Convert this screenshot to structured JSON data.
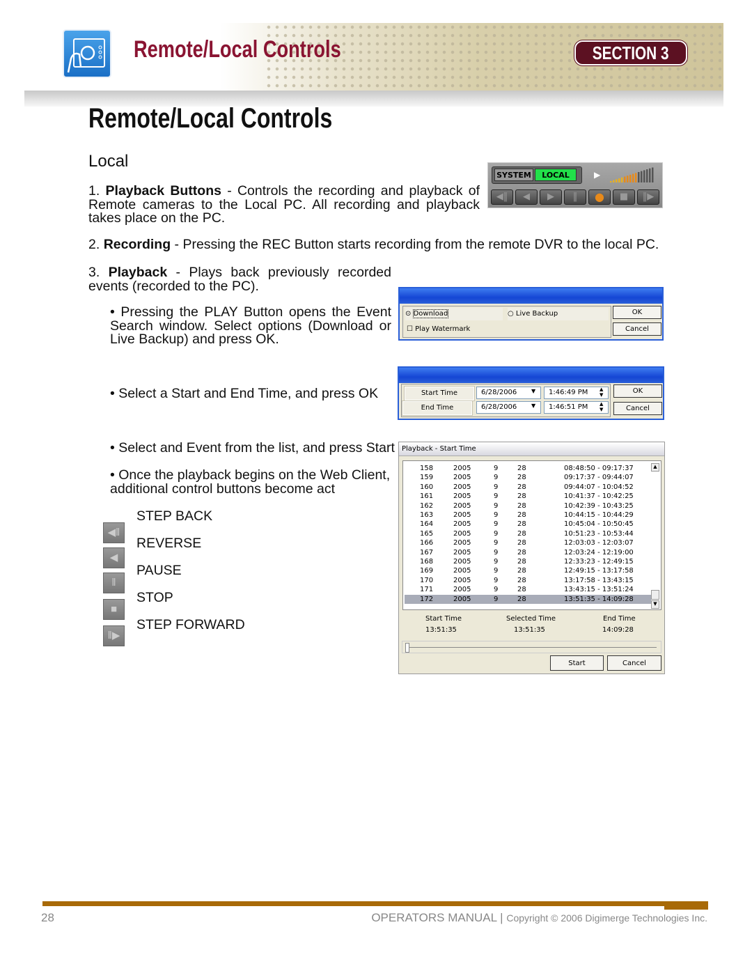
{
  "header": {
    "banner_title": "Remote/Local Controls",
    "section": "SECTION 3"
  },
  "page_title": "Remote/Local Controls",
  "subtitle": "Local",
  "items": [
    {
      "num": "1.",
      "bold": "Playback Buttons",
      "text": " - Controls the recording and playback of Remote cameras to the Local PC. All recording and playback takes place on the PC."
    },
    {
      "num": "2.",
      "bold": "Recording",
      "text": " - Pressing the REC Button starts recording from the remote DVR to the local PC."
    },
    {
      "num": "3.",
      "bold": "Playback",
      "text": " - Plays back previously recorded events (recorded to the PC)."
    }
  ],
  "bullets": [
    "• Pressing the PLAY Button opens the Event Search window. Select options (Download or Live Backup) and press OK.",
    "• Select a Start and End Time, and press OK",
    "• Select and Event from the list, and press Start",
    "• Once the playback begins on the Web Client, additional control buttons become act"
  ],
  "controls": [
    {
      "label": "STEP BACK",
      "icon": "step-back-icon"
    },
    {
      "label": "REVERSE",
      "icon": "reverse-icon"
    },
    {
      "label": "PAUSE",
      "icon": "pause-icon"
    },
    {
      "label": "STOP",
      "icon": "stop-icon"
    },
    {
      "label": "STEP FORWARD",
      "icon": "step-forward-icon"
    }
  ],
  "toolbar": {
    "system": "SYSTEM",
    "local": "LOCAL",
    "local_color": "#22e04a",
    "rec_color": "#e88a1a"
  },
  "options_dialog": {
    "download": "Download",
    "live_backup": "Live Backup",
    "play_watermark": "Play Watermark",
    "ok": "OK",
    "cancel": "Cancel",
    "download_selected": true,
    "watermark_checked": false
  },
  "time_dialog": {
    "start_label": "Start Time",
    "end_label": "End Time",
    "start_date": "6/28/2006",
    "start_time": "1:46:49 PM",
    "end_date": "6/28/2006",
    "end_time": "1:46:51 PM",
    "ok": "OK",
    "cancel": "Cancel"
  },
  "playback": {
    "title": "Playback - Start Time",
    "rows": [
      [
        "158",
        "2005",
        "9",
        "28",
        "08:48:50 - 09:17:37"
      ],
      [
        "159",
        "2005",
        "9",
        "28",
        "09:17:37 - 09:44:07"
      ],
      [
        "160",
        "2005",
        "9",
        "28",
        "09:44:07 - 10:04:52"
      ],
      [
        "161",
        "2005",
        "9",
        "28",
        "10:41:37 - 10:42:25"
      ],
      [
        "162",
        "2005",
        "9",
        "28",
        "10:42:39 - 10:43:25"
      ],
      [
        "163",
        "2005",
        "9",
        "28",
        "10:44:15 - 10:44:29"
      ],
      [
        "164",
        "2005",
        "9",
        "28",
        "10:45:04 - 10:50:45"
      ],
      [
        "165",
        "2005",
        "9",
        "28",
        "10:51:23 - 10:53:44"
      ],
      [
        "166",
        "2005",
        "9",
        "28",
        "12:03:03 - 12:03:07"
      ],
      [
        "167",
        "2005",
        "9",
        "28",
        "12:03:24 - 12:19:00"
      ],
      [
        "168",
        "2005",
        "9",
        "28",
        "12:33:23 - 12:49:15"
      ],
      [
        "169",
        "2005",
        "9",
        "28",
        "12:49:15 - 13:17:58"
      ],
      [
        "170",
        "2005",
        "9",
        "28",
        "13:17:58 - 13:43:15"
      ],
      [
        "171",
        "2005",
        "9",
        "28",
        "13:43:15 - 13:51:24"
      ],
      [
        "172",
        "2005",
        "9",
        "28",
        "13:51:35 - 14:09:28"
      ]
    ],
    "selected_row": "172",
    "start_label": "Start Time",
    "start_value": "13:51:35",
    "selected_label": "Selected Time",
    "selected_value": "13:51:35",
    "end_label": "End Time",
    "end_value": "14:09:28",
    "start_btn": "Start",
    "cancel_btn": "Cancel",
    "slider_fraction": 0
  },
  "footer": {
    "page": "28",
    "manual": "OPERATORS MANUAL",
    "sep": " | ",
    "copyright": "Copyright © 2006 Digimerge Technologies Inc.",
    "bar_color": "#a86a08"
  }
}
